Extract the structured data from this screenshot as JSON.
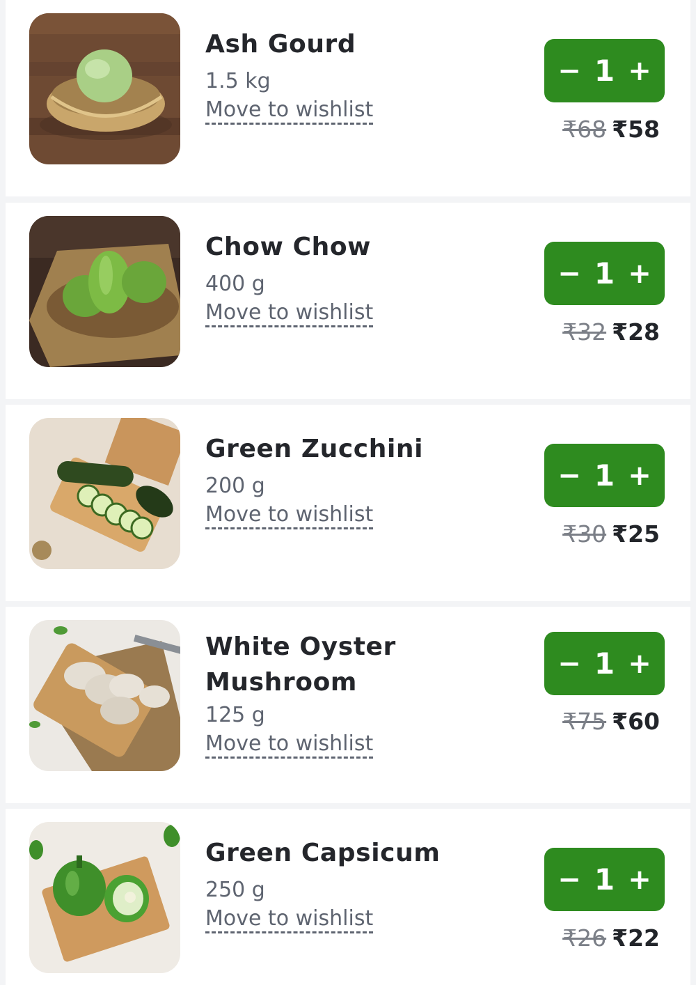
{
  "cart": {
    "wishlist_label": "Move to wishlist",
    "minus_symbol": "−",
    "plus_symbol": "+",
    "items": [
      {
        "name": "Ash Gourd",
        "weight": "1.5 kg",
        "qty": "1",
        "mrp": "₹68",
        "price": "₹58",
        "image_icon": "ash-gourd-image"
      },
      {
        "name": "Chow Chow",
        "weight": "400 g",
        "qty": "1",
        "mrp": "₹32",
        "price": "₹28",
        "image_icon": "chow-chow-image"
      },
      {
        "name": "Green Zucchini",
        "weight": "200 g",
        "qty": "1",
        "mrp": "₹30",
        "price": "₹25",
        "image_icon": "zucchini-image"
      },
      {
        "name": "White Oyster Mushroom",
        "weight": "125 g",
        "qty": "1",
        "mrp": "₹75",
        "price": "₹60",
        "image_icon": "mushroom-image"
      },
      {
        "name": "Green Capsicum",
        "weight": "250 g",
        "qty": "1",
        "mrp": "₹26",
        "price": "₹22",
        "image_icon": "capsicum-image"
      }
    ]
  },
  "colors": {
    "accent_green": "#2e8b1f",
    "text_primary": "#24262b",
    "text_secondary": "#5e6470",
    "background": "#f3f4f6"
  }
}
